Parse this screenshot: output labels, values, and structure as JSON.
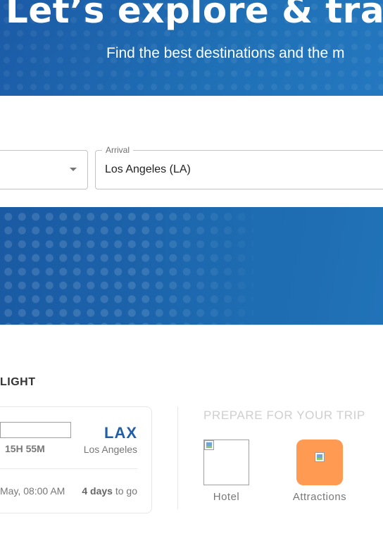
{
  "hero": {
    "title": "Let’s explore & trav",
    "subtitle": "Find the best destinations and the m"
  },
  "search": {
    "departure_value": "",
    "arrival_label": "Arrival",
    "arrival_value": "Los Angeles (LA)"
  },
  "flight": {
    "heading": "LIGHT",
    "duration": "15H 55M",
    "arrival_code": "LAX",
    "arrival_city": "Los Angeles",
    "departure_time": "May, 08:00 AM",
    "days_count": "4 days",
    "days_suffix": " to go"
  },
  "prepare": {
    "title": "PREPARE FOR YOUR TRIP",
    "items": [
      {
        "label": "Hotel",
        "icon": "hotel-icon"
      },
      {
        "label": "Attractions",
        "icon": "attractions-icon",
        "color": "#ff9a52"
      }
    ]
  },
  "colors": {
    "brand_blue": "#1f5ea8",
    "accent_orange": "#ff9a52"
  }
}
